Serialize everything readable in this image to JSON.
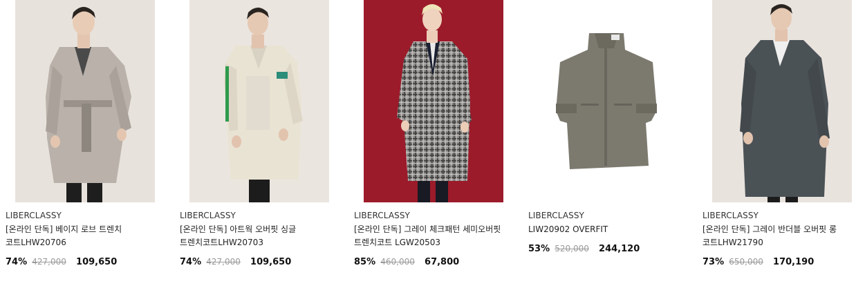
{
  "products": [
    {
      "brand": "LIBERCLASSY",
      "title": "[온라인 단독] 베이지 로브 트렌치 코트LHW20706",
      "discount": "74%",
      "original_price": "427,000",
      "sale_price": "109,650",
      "image": "model-beige-robe-trench-coat"
    },
    {
      "brand": "LIBERCLASSY",
      "title": "[온라인 단독] 아트웍 오버핏 싱글 트렌치코트LHW20703",
      "discount": "74%",
      "original_price": "427,000",
      "sale_price": "109,650",
      "image": "model-cream-single-trench-coat"
    },
    {
      "brand": "LIBERCLASSY",
      "title": "[온라인 단독] 그레이 체크패턴 세미오버핏 트렌치코트 LGW20503",
      "discount": "85%",
      "original_price": "460,000",
      "sale_price": "67,800",
      "image": "model-grey-check-trench-coat"
    },
    {
      "brand": "LIBERCLASSY",
      "title": "LIW20902 OVERFIT",
      "discount": "53%",
      "original_price": "520,000",
      "sale_price": "244,120",
      "image": "khaki-overfit-coat-flat"
    },
    {
      "brand": "LIBERCLASSY",
      "title": "[온라인 단독] 그레이 반더블 오버핏 롱 코트LHW21790",
      "discount": "73%",
      "original_price": "650,000",
      "sale_price": "170,190",
      "image": "model-grey-long-coat"
    }
  ]
}
